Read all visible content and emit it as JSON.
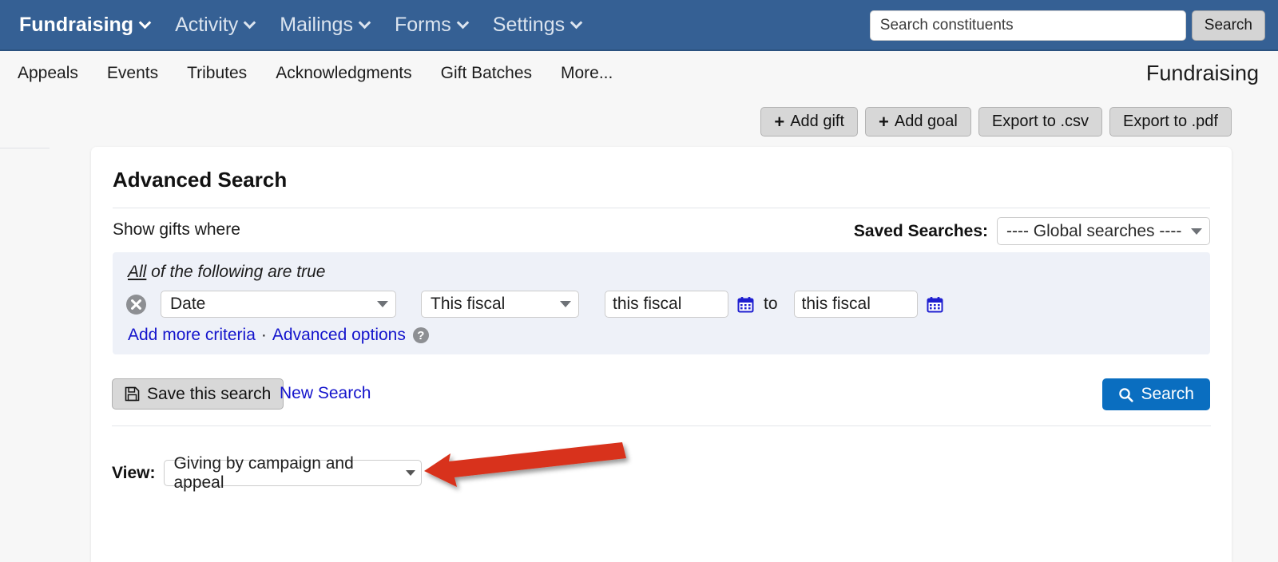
{
  "topnav": {
    "items": [
      {
        "label": "Fundraising",
        "icon": "chevron-down-icon",
        "brand": true
      },
      {
        "label": "Activity",
        "icon": "chevron-down-icon",
        "brand": false
      },
      {
        "label": "Mailings",
        "icon": "chevron-down-icon",
        "brand": false
      },
      {
        "label": "Forms",
        "icon": "chevron-down-icon",
        "brand": false
      },
      {
        "label": "Settings",
        "icon": "chevron-down-icon",
        "brand": false
      }
    ],
    "search": {
      "placeholder": "Search constituents",
      "value": "",
      "button_label": "Search"
    },
    "bar_color": "#356094"
  },
  "subnav": {
    "items": [
      "Appeals",
      "Events",
      "Tributes",
      "Acknowledgments",
      "Gift Batches",
      "More..."
    ],
    "page_title": "Fundraising"
  },
  "actions": [
    {
      "label": "Add gift",
      "icon": "plus-icon"
    },
    {
      "label": "Add goal",
      "icon": "plus-icon"
    },
    {
      "label": "Export to .csv",
      "icon": ""
    },
    {
      "label": "Export to .pdf",
      "icon": ""
    }
  ],
  "card": {
    "title": "Advanced Search",
    "show_gifts_where": "Show gifts where",
    "saved_searches_label": "Saved Searches:",
    "saved_searches_value": "---- Global searches ----",
    "criteria": {
      "conjunction_prefix": "All",
      "conjunction_suffix": " of the following are true",
      "field_value": "Date",
      "operator_value": "This fiscal",
      "date_from": "this fiscal",
      "date_to": "this fiscal",
      "to_word": "to",
      "add_more_criteria": "Add more criteria",
      "separator": "·",
      "advanced_options": "Advanced options",
      "help_glyph": "?",
      "panel_color": "#eef1f8"
    },
    "save_search_label": "Save this search",
    "new_search_label": "New Search",
    "search_button_label": "Search",
    "search_button_color": "#0a6ec0",
    "view_label": "View:",
    "view_value": "Giving by campaign and appeal"
  },
  "annotation": {
    "arrow_color": "#d8331b",
    "arrow_name": "red-arrow-pointing-to-view-dropdown"
  }
}
